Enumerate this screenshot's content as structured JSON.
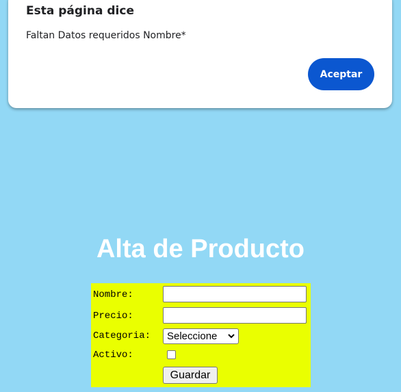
{
  "alert": {
    "title": "Esta página dice",
    "message": "Faltan Datos requeridos Nombre*",
    "accept_label": "Aceptar"
  },
  "page": {
    "title": "Alta de Producto"
  },
  "form": {
    "nombre_label": "Nombre:",
    "nombre_value": "",
    "precio_label": "Precio:",
    "precio_value": "",
    "categoria_label": "Categoria:",
    "categoria_selected": "Seleccione",
    "activo_label": "Activo:",
    "activo_checked": false,
    "submit_label": "Guardar"
  },
  "colors": {
    "background": "#92d8f5",
    "form_background": "#eaff00",
    "accent_button": "#0b57d0"
  }
}
